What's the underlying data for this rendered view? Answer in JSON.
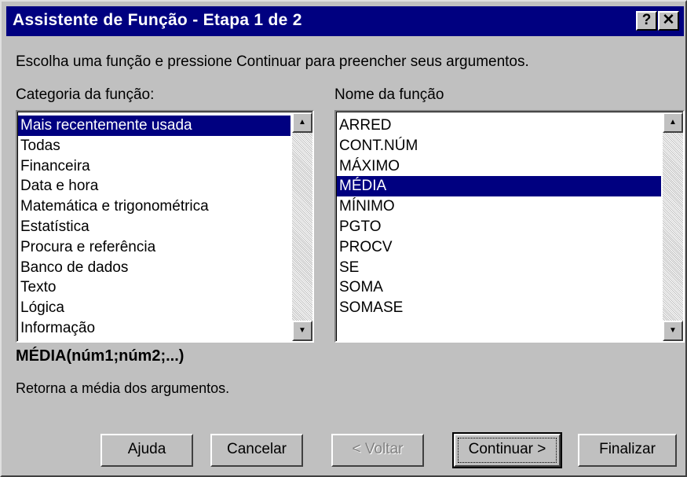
{
  "window": {
    "title": "Assistente de Função - Etapa 1 de 2",
    "help_glyph": "?",
    "close_glyph": "✕"
  },
  "instruction": "Escolha uma função e pressione Continuar para preencher seus argumentos.",
  "category": {
    "label": "Categoria da função:",
    "items": [
      "Mais recentemente usada",
      "Todas",
      "Financeira",
      "Data e hora",
      "Matemática e trigonométrica",
      "Estatística",
      "Procura e referência",
      "Banco de dados",
      "Texto",
      "Lógica",
      "Informação"
    ],
    "selected": "Mais recentemente usada"
  },
  "function_name": {
    "label": "Nome da função",
    "items": [
      "ARRED",
      "CONT.NÚM",
      "MÁXIMO",
      "MÉDIA",
      "MÍNIMO",
      "PGTO",
      "PROCV",
      "SE",
      "SOMA",
      "SOMASE"
    ],
    "selected": "MÉDIA"
  },
  "syntax": "MÉDIA(núm1;núm2;...)",
  "description": "Retorna a média dos argumentos.",
  "buttons": {
    "help": "Ajuda",
    "cancel": "Cancelar",
    "back": "< Voltar",
    "continue": "Continuar >",
    "finish": "Finalizar"
  },
  "colors": {
    "titlebar": "#000080",
    "face": "#c0c0c0",
    "selection": "#000080"
  }
}
